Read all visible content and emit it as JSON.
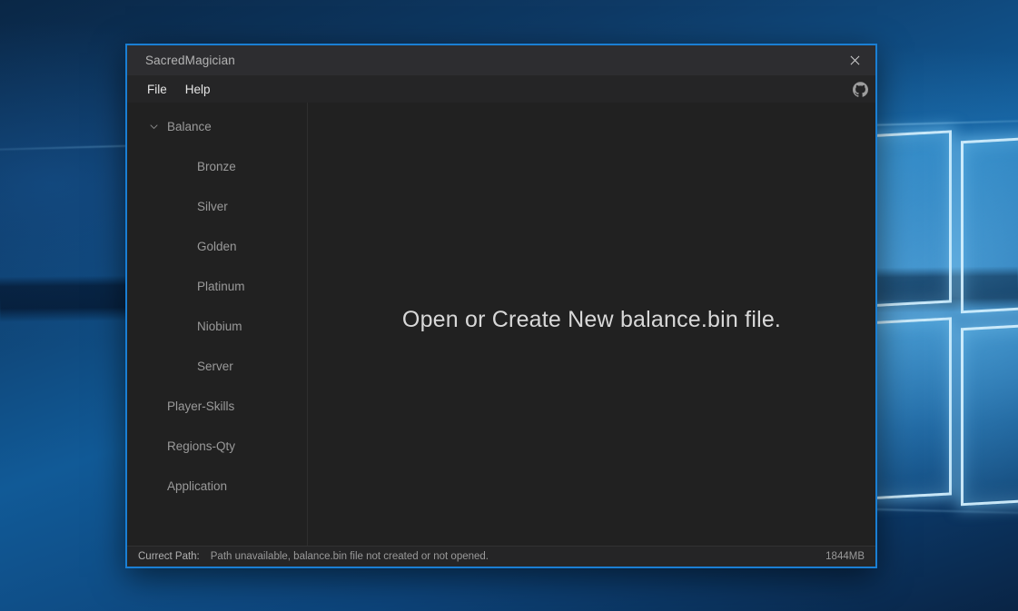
{
  "desktop": {
    "wallpaper_name": "windows-10-hero-wallpaper",
    "colors": {
      "deep_blue": "#0a2746",
      "mid_blue": "#115a97",
      "glow_blue": "#78cdff"
    }
  },
  "window": {
    "title": "SacredMagician",
    "accent_border_color": "#1a7fd4",
    "close_icon": "close-icon",
    "close_label": "Close"
  },
  "menu": {
    "items": [
      {
        "label": "File",
        "name": "menu-file"
      },
      {
        "label": "Help",
        "name": "menu-help"
      }
    ],
    "github_icon": "github-octocat-icon",
    "github_label": "GitHub"
  },
  "sidebar": {
    "tree": [
      {
        "label": "Balance",
        "level": 0,
        "expanded": true,
        "chevron": "chevron-down-icon",
        "name": "tree-item-balance"
      },
      {
        "label": "Bronze",
        "level": 1,
        "name": "tree-item-bronze"
      },
      {
        "label": "Silver",
        "level": 1,
        "name": "tree-item-silver"
      },
      {
        "label": "Golden",
        "level": 1,
        "name": "tree-item-golden"
      },
      {
        "label": "Platinum",
        "level": 1,
        "name": "tree-item-platinum"
      },
      {
        "label": "Niobium",
        "level": 1,
        "name": "tree-item-niobium"
      },
      {
        "label": "Server",
        "level": 1,
        "name": "tree-item-server"
      },
      {
        "label": "Player-Skills",
        "level": 0,
        "name": "tree-item-player-skills"
      },
      {
        "label": "Regions-Qty",
        "level": 0,
        "name": "tree-item-regions-qty"
      },
      {
        "label": "Application",
        "level": 0,
        "name": "tree-item-application"
      }
    ]
  },
  "content": {
    "placeholder": "Open or Create New balance.bin file."
  },
  "status": {
    "path_label": "Currect Path:",
    "path_value": "Path unavailable, balance.bin file not created or not opened.",
    "memory": "1844MB"
  }
}
